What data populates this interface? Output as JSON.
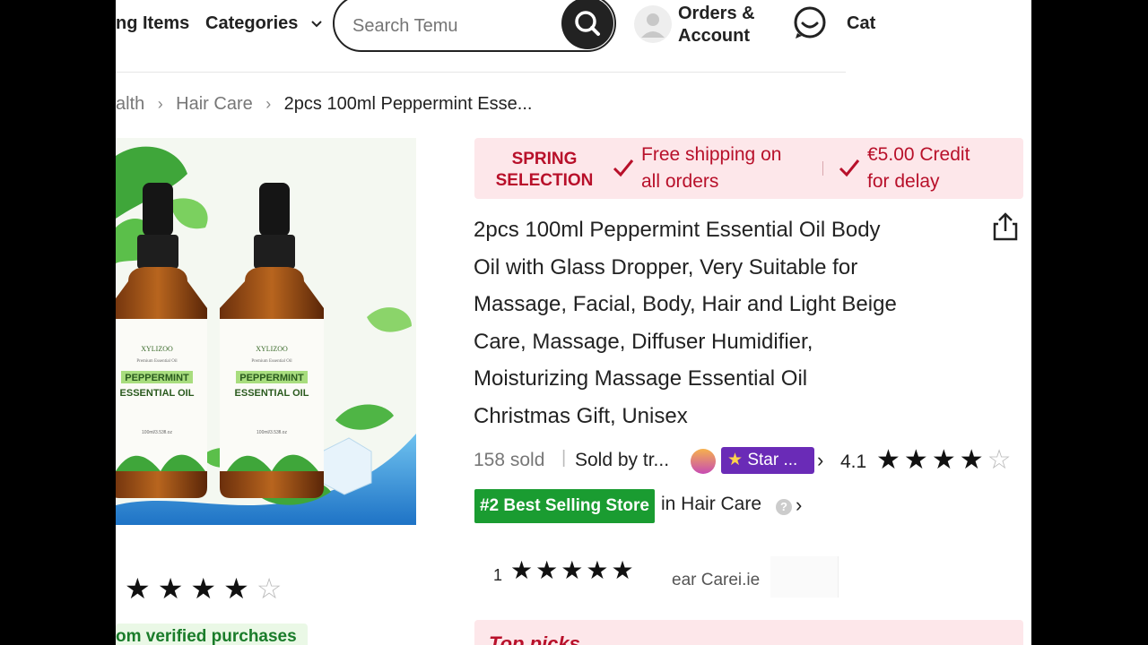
{
  "header": {
    "nav_items": [
      "ng Items",
      "Categories"
    ],
    "search_placeholder": "Search Temu",
    "orders_line1": "Orders &",
    "orders_line2": "Account",
    "cart_label": "Cat"
  },
  "breadcrumb": [
    "alth",
    "Hair Care",
    "2pcs 100ml Peppermint Esse..."
  ],
  "banner": {
    "spring_line1": "SPRING",
    "spring_line2": "SELECTION",
    "shipping_line1": "Free shipping on",
    "shipping_line2": "all orders",
    "credit_line1": "€5.00 Credit",
    "credit_line2": "for delay"
  },
  "product": {
    "title_lines": [
      "2pcs 100ml Peppermint Essential Oil Body",
      "Oil with Glass Dropper, Very Suitable for",
      "Massage, Facial, Body, Hair and Light Beige",
      "Care, Massage, Diffuser Humidifier,",
      "Moisturizing Massage Essential Oil",
      "Christmas Gift, Unisex"
    ],
    "sold": "158 sold",
    "sold_by": "Sold by tr...",
    "store_badge": "Star ...",
    "rating": "4.1",
    "rating_stars_filled": 4,
    "best_selling": "#2 Best Selling Store",
    "best_selling_category": "in Hair Care",
    "bottle_brand": "XYLIZOO",
    "bottle_sub": "Premium Essential Oil",
    "bottle_name1": "PEPPERMINT",
    "bottle_name2": "ESSENTIAL OIL",
    "bottle_size": "100ml/3.53fl.oz"
  },
  "reviews": {
    "verified_text": "om verified purchases",
    "stars_filled": 4
  },
  "ghost_row": {
    "lead": "1",
    "text": "ear Carei.ie"
  },
  "top_picks": "Top picks",
  "colors": {
    "banner_bg": "#fde7ea",
    "banner_text": "#b8102a",
    "best_selling_bg": "#1a9c31",
    "store_badge_bg": "#6a2bb7"
  }
}
